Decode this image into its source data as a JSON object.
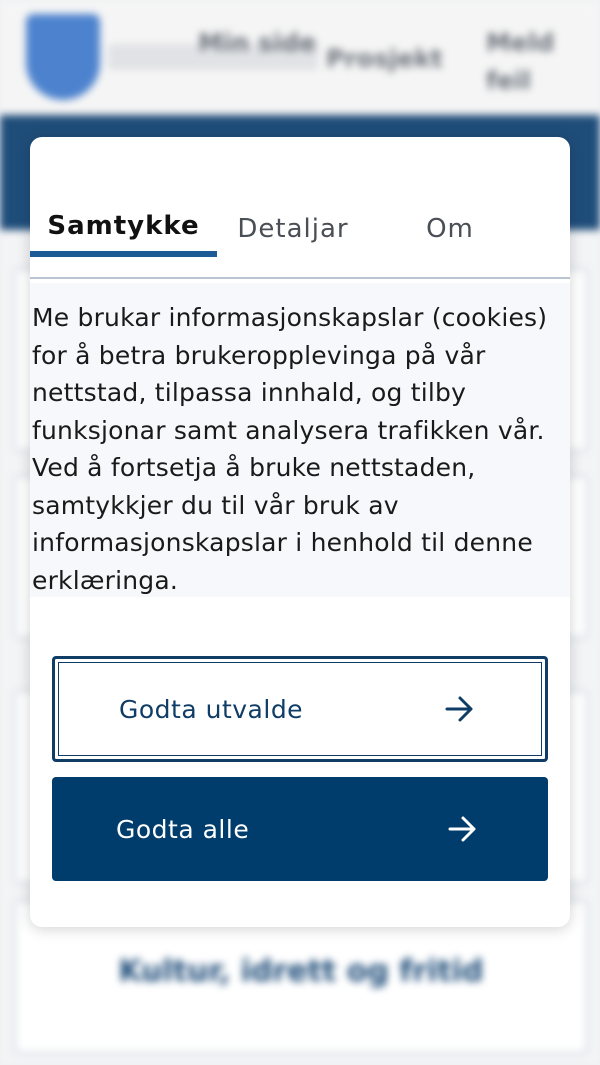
{
  "background": {
    "nav": [
      "Meld feil",
      "Min side",
      "Prosjekt",
      "Meld feil"
    ],
    "card_label": "Kultur, idrett og fritid"
  },
  "consent": {
    "tabs": [
      {
        "label": "Samtykke",
        "active": true
      },
      {
        "label": "Detaljar",
        "active": false
      },
      {
        "label": "Om",
        "active": false
      }
    ],
    "text": "Me brukar informasjonskapslar (cookies) for å betra brukeropplevinga på vår nettstad, tilpassa innhald, og tilby funksjonar samt analysera trafikken vår. Ved å fortsetja å bruke nettstaden, samtykkjer du til vår bruk av informasjonskapslar i henhold til denne erklæringa.",
    "buttons": {
      "accept_selected": "Godta utvalde",
      "accept_all": "Godta alle"
    },
    "icons": {
      "button_arrow": "arrow-right-icon"
    }
  },
  "colors": {
    "primary": "#003c6c",
    "tab_indicator": "#1d5a96",
    "header_band": "#1f4d7a"
  }
}
